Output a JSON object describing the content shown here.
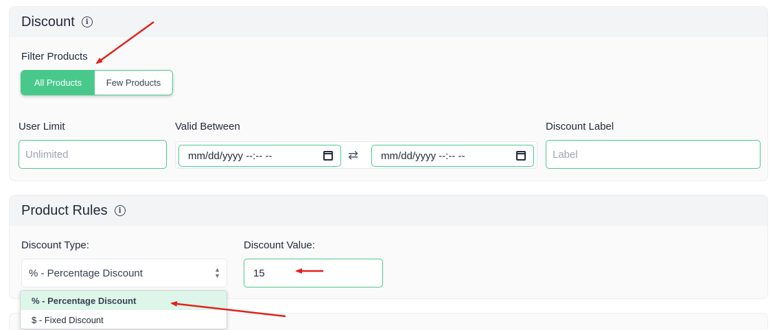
{
  "discount": {
    "title": "Discount",
    "filter_products_label": "Filter Products",
    "filter_options": [
      "All Products",
      "Few Products"
    ],
    "user_limit_label": "User Limit",
    "user_limit_placeholder": "Unlimited",
    "valid_between_label": "Valid Between",
    "date_start": "mm/dd/yyyy --:-- --",
    "date_end": "mm/dd/yyyy --:-- --",
    "discount_label_label": "Discount Label",
    "discount_label_placeholder": "Label"
  },
  "product_rules": {
    "title": "Product Rules",
    "discount_type_label": "Discount Type:",
    "discount_type_selected": "% - Percentage Discount",
    "discount_value_label": "Discount Value:",
    "discount_value": "15"
  },
  "dropdown": {
    "options": [
      "% - Percentage Discount",
      "$ - Fixed Discount"
    ]
  },
  "colors": {
    "accent": "#48c98b",
    "annotation": "#e3201b"
  },
  "icons": {
    "info": "info-circle-icon",
    "swap": "swap-arrows-icon",
    "calendar": "calendar-icon",
    "select": "chevron-up-down-icon"
  }
}
